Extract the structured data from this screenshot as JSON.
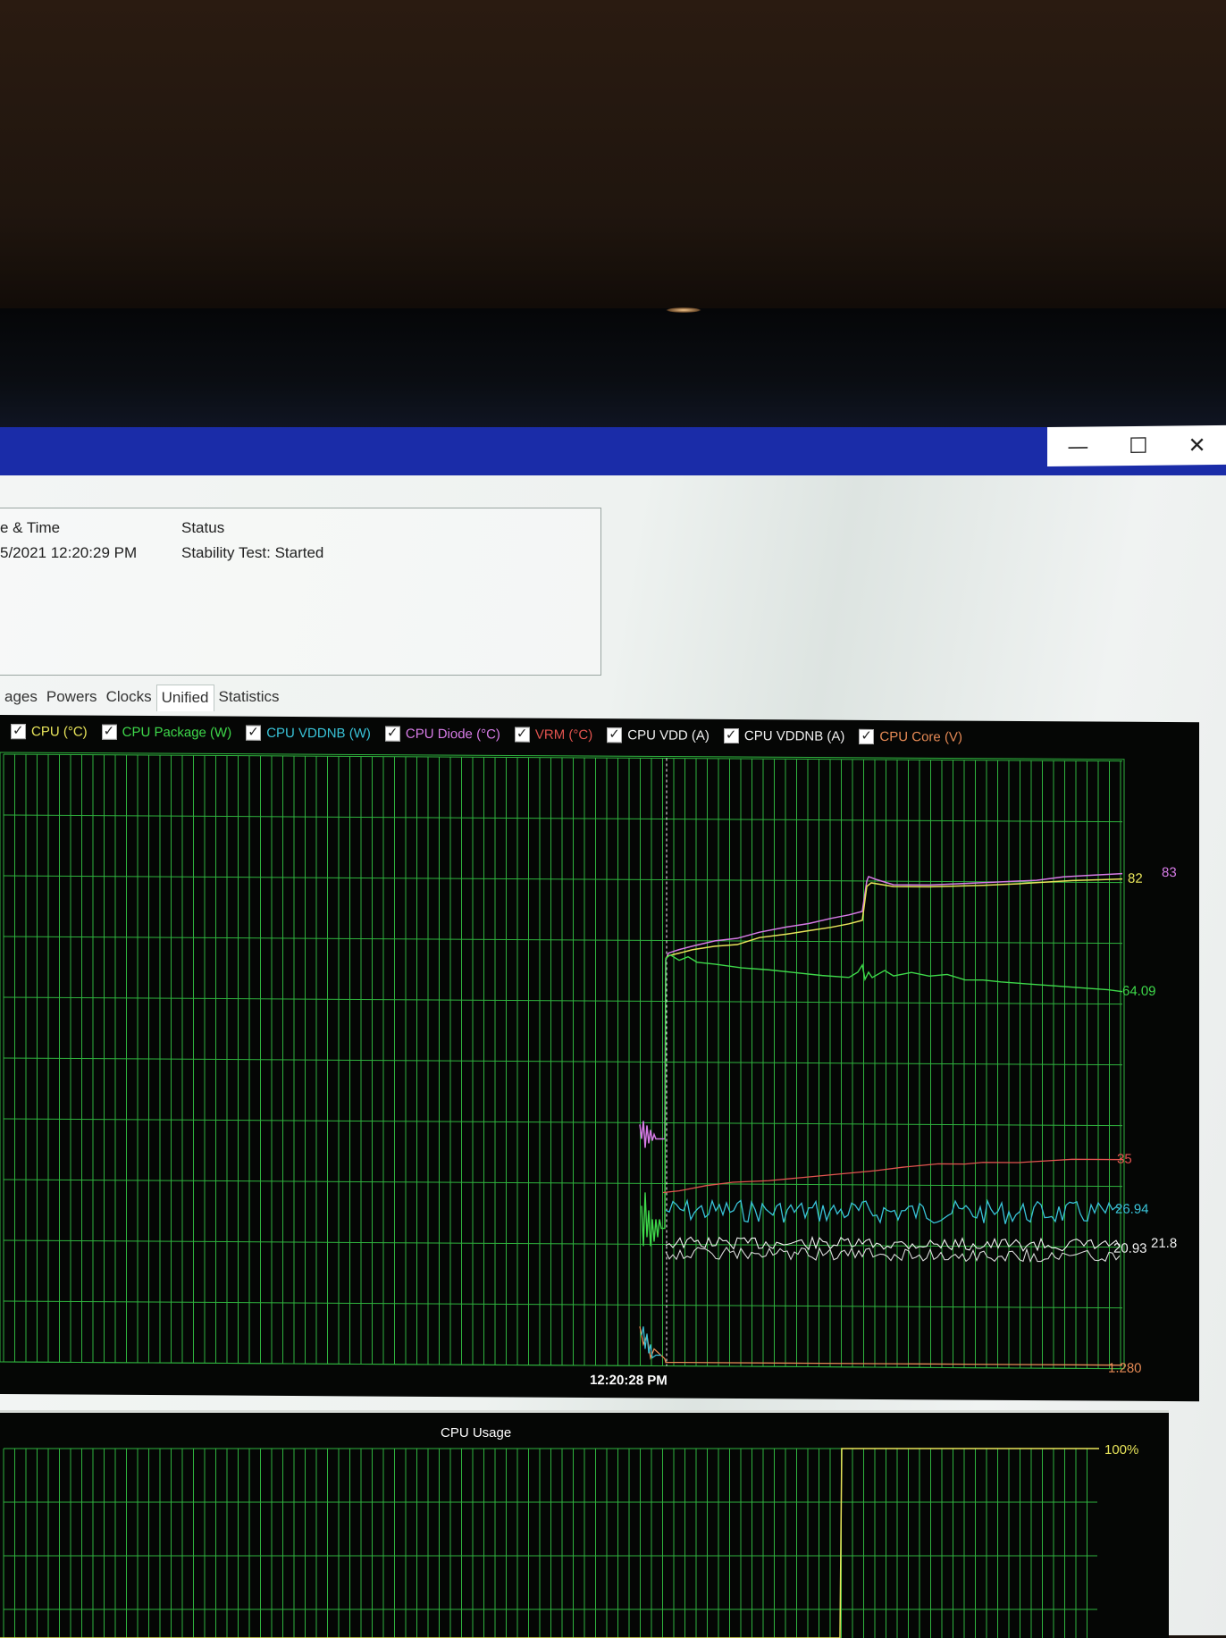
{
  "window": {
    "controls": {
      "minimize": "—",
      "maximize": "☐",
      "close": "✕"
    }
  },
  "log": {
    "col_date_header": "e & Time",
    "col_status_header": "Status",
    "rows": [
      {
        "date": "5/2021 12:20:29 PM",
        "status": "Stability Test: Started"
      }
    ]
  },
  "tabs": [
    "ages",
    "Powers",
    "Clocks",
    "Unified",
    "Statistics"
  ],
  "active_tab": "Unified",
  "legend": [
    {
      "label": "CPU (°C)",
      "color": "#e8e45a"
    },
    {
      "label": "CPU Package (W)",
      "color": "#3ed84a"
    },
    {
      "label": "CPU VDDNB (W)",
      "color": "#39c3d8"
    },
    {
      "label": "CPU Diode (°C)",
      "color": "#d67be6"
    },
    {
      "label": "VRM (°C)",
      "color": "#e2544f"
    },
    {
      "label": "CPU VDD (A)",
      "color": "#f0f0f0"
    },
    {
      "label": "CPU VDDNB (A)",
      "color": "#f0f0f0"
    },
    {
      "label": "CPU Core (V)",
      "color": "#e68a55"
    }
  ],
  "graph": {
    "time_label": "12:20:28 PM",
    "value_labels": [
      {
        "text": "82",
        "color": "#e8e45a"
      },
      {
        "text": "83",
        "color": "#d67be6"
      },
      {
        "text": "64.09",
        "color": "#3ed84a"
      },
      {
        "text": "35",
        "color": "#e2544f"
      },
      {
        "text": "26.94",
        "color": "#39c3d8"
      },
      {
        "text": "20.93",
        "color": "#f0f0f0"
      },
      {
        "text": "21.8",
        "color": "#f0f0f0"
      },
      {
        "text": "1.280",
        "color": "#e68a55"
      }
    ]
  },
  "usage": {
    "title": "CPU Usage",
    "max_label": "100%",
    "color": "#e8e45a"
  },
  "grid_color": "#2fb33e"
}
